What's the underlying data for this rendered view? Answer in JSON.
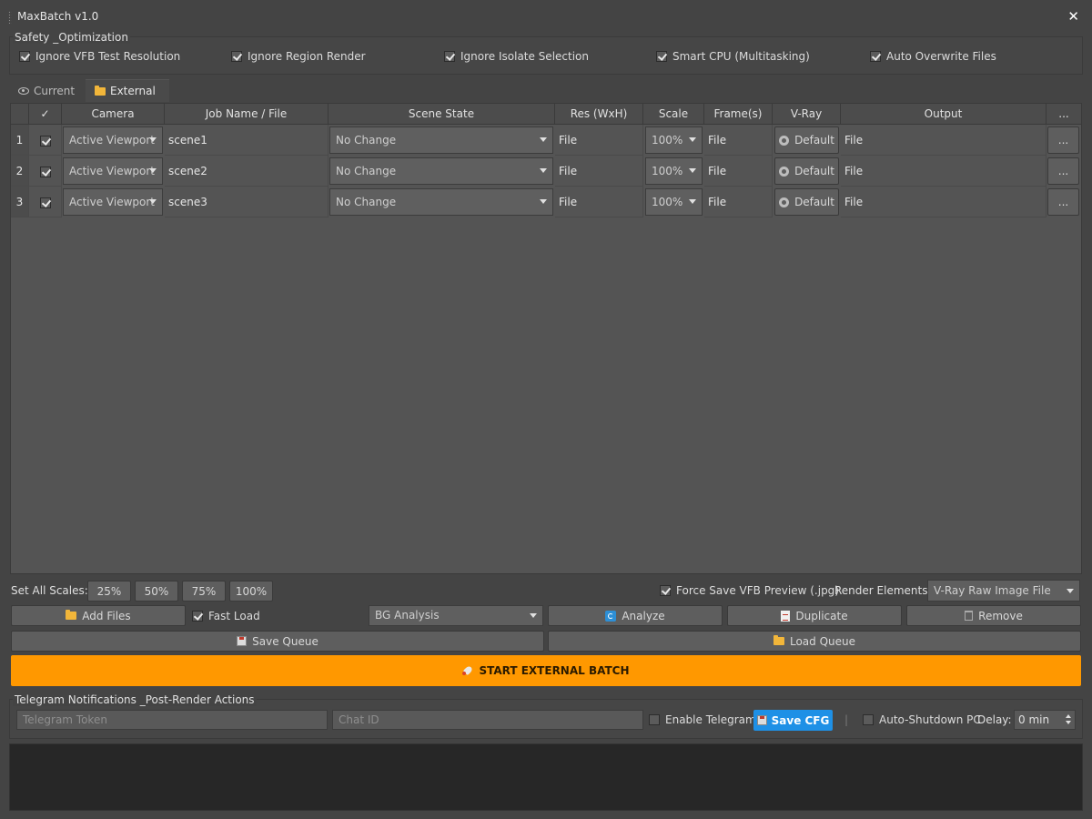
{
  "window": {
    "title": "MaxBatch v1.0",
    "close_glyph": "✕"
  },
  "safety": {
    "label": "Safety _Optimization",
    "options": [
      {
        "label": "Ignore VFB Test Resolution",
        "checked": true
      },
      {
        "label": "Ignore Region Render",
        "checked": true
      },
      {
        "label": "Ignore Isolate Selection",
        "checked": true
      },
      {
        "label": "Smart CPU (Multitasking)",
        "checked": true
      },
      {
        "label": "Auto Overwrite Files",
        "checked": true
      }
    ]
  },
  "tabs": [
    {
      "label": "Current",
      "icon": "eye-icon",
      "active": false
    },
    {
      "label": "External",
      "icon": "folder-icon",
      "active": true
    }
  ],
  "table": {
    "headers": [
      "",
      "✓",
      "Camera",
      "Job Name / File",
      "Scene State",
      "Res (WxH)",
      "Scale",
      "Frame(s)",
      "V-Ray",
      "Output",
      "..."
    ],
    "rows": [
      {
        "num": "1",
        "checked": true,
        "camera": "Active Viewport",
        "job": "scene1",
        "scene_state": "No Change",
        "res": "File",
        "scale": "100%",
        "frames": "File",
        "vray": "Default",
        "output": "File",
        "more": "..."
      },
      {
        "num": "2",
        "checked": true,
        "camera": "Active Viewport",
        "job": "scene2",
        "scene_state": "No Change",
        "res": "File",
        "scale": "100%",
        "frames": "File",
        "vray": "Default",
        "output": "File",
        "more": "..."
      },
      {
        "num": "3",
        "checked": true,
        "camera": "Active Viewport",
        "job": "scene3",
        "scene_state": "No Change",
        "res": "File",
        "scale": "100%",
        "frames": "File",
        "vray": "Default",
        "output": "File",
        "more": "..."
      }
    ]
  },
  "scales": {
    "label": "Set All Scales:",
    "buttons": [
      "25%",
      "50%",
      "75%",
      "100%"
    ]
  },
  "force_save": {
    "label": "Force Save VFB Preview (.jpg)",
    "checked": true
  },
  "render_elements": {
    "label": "Render Elements:",
    "value": "V-Ray Raw Image File"
  },
  "actions": {
    "add_files": "Add Files",
    "fast_load": {
      "label": "Fast Load",
      "checked": true
    },
    "bg_analysis": "BG Analysis",
    "analyze": "Analyze",
    "duplicate": "Duplicate",
    "remove": "Remove",
    "save_queue": "Save Queue",
    "load_queue": "Load Queue",
    "start": "START EXTERNAL BATCH"
  },
  "telegram": {
    "label": "Telegram Notifications _Post-Render Actions",
    "token_placeholder": "Telegram Token",
    "chat_placeholder": "Chat ID",
    "enable": {
      "label": "Enable Telegram",
      "checked": false
    },
    "save_cfg": "Save CFG",
    "separator": "|",
    "shutdown": {
      "label": "Auto-Shutdown PC",
      "checked": false
    },
    "delay_label": "Delay:",
    "delay_value": "0 min"
  },
  "colors": {
    "accent": "#ff9800",
    "primary": "#1e90e6",
    "background": "#444444"
  }
}
